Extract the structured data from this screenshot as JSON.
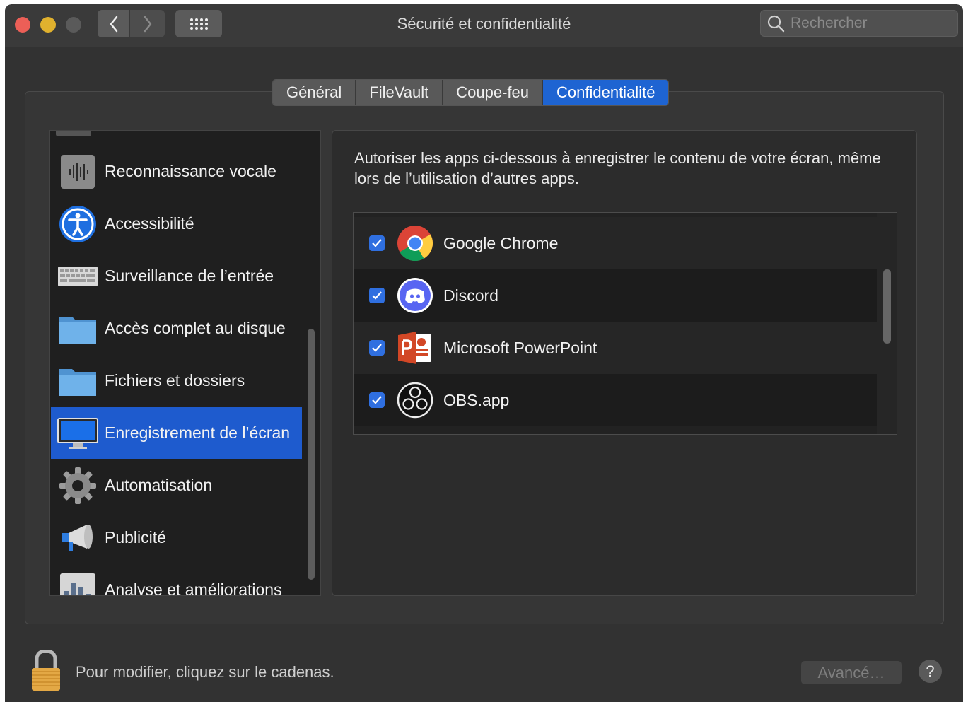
{
  "window": {
    "title": "Sécurité et confidentialité",
    "search_placeholder": "Rechercher"
  },
  "tabs": [
    {
      "label": "Général",
      "active": false
    },
    {
      "label": "FileVault",
      "active": false
    },
    {
      "label": "Coupe-feu",
      "active": false
    },
    {
      "label": "Confidentialité",
      "active": true
    }
  ],
  "sidebar": {
    "items": [
      {
        "label": "Reconnaissance vocale",
        "icon": "waveform-icon"
      },
      {
        "label": "Accessibilité",
        "icon": "accessibility-icon"
      },
      {
        "label": "Surveillance de l’entrée",
        "icon": "keyboard-icon"
      },
      {
        "label": "Accès complet au disque",
        "icon": "folder-icon"
      },
      {
        "label": "Fichiers et dossiers",
        "icon": "folder-icon"
      },
      {
        "label": "Enregistrement de l’écran",
        "icon": "display-icon",
        "selected": true
      },
      {
        "label": "Automatisation",
        "icon": "gear-icon"
      },
      {
        "label": "Publicité",
        "icon": "megaphone-icon"
      },
      {
        "label": "Analyse et améliorations",
        "icon": "bar-chart-icon"
      }
    ]
  },
  "content": {
    "description": "Autoriser les apps ci-dessous à enregistrer le contenu de votre écran, même lors de l’utilisation d’autres apps.",
    "apps": [
      {
        "name": "Google Chrome",
        "checked": true,
        "icon": "chrome-icon"
      },
      {
        "name": "Discord",
        "checked": true,
        "icon": "discord-icon"
      },
      {
        "name": "Microsoft PowerPoint",
        "checked": true,
        "icon": "powerpoint-icon"
      },
      {
        "name": "OBS.app",
        "checked": true,
        "icon": "obs-icon"
      }
    ]
  },
  "footer": {
    "lock_text": "Pour modifier, cliquez sur le cadenas.",
    "advanced_label": "Avancé…",
    "help_label": "?"
  },
  "colors": {
    "accent": "#1e64d2",
    "selection": "#1e5bce",
    "close": "#ec5f57",
    "minimize": "#e0b12e"
  }
}
